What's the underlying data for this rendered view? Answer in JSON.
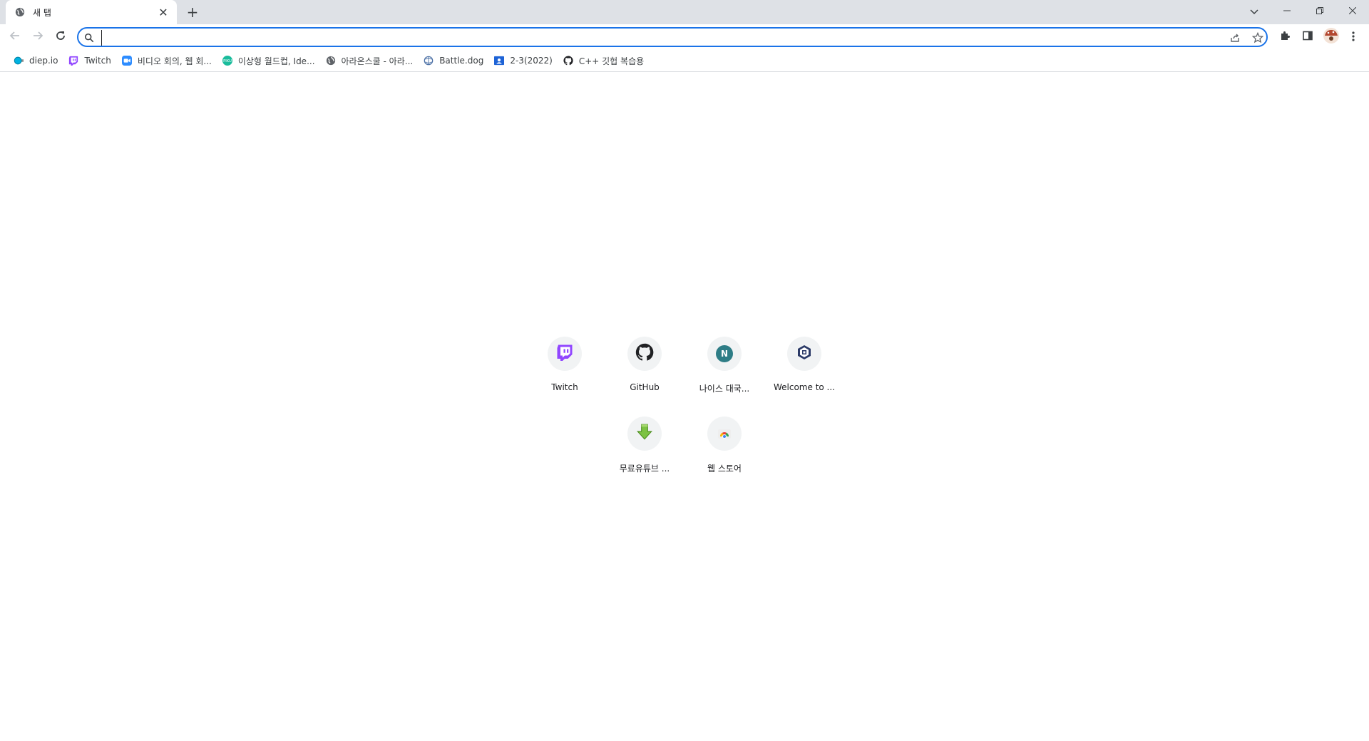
{
  "tab": {
    "title": "새 탭",
    "close": "✕"
  },
  "newtab": "+",
  "window_controls": {
    "minimize": "─",
    "restore": "❐",
    "close": "✕"
  },
  "omnibox": {
    "value": "",
    "placeholder": ""
  },
  "bookmarks": [
    {
      "label": "diep.io",
      "icon": "diep-icon"
    },
    {
      "label": "Twitch",
      "icon": "twitch-icon"
    },
    {
      "label": "비디오 회의, 웹 회...",
      "icon": "zoom-icon"
    },
    {
      "label": "이상형 월드컵, Ide...",
      "icon": "piku-icon"
    },
    {
      "label": "아라온스쿨 - 아라...",
      "icon": "globe-icon"
    },
    {
      "label": "Battle.dog",
      "icon": "battledog-icon"
    },
    {
      "label": "2-3(2022)",
      "icon": "classroom-icon"
    },
    {
      "label": "C++ 깃헙 복습용",
      "icon": "github-icon"
    }
  ],
  "shortcuts": [
    {
      "label": "Twitch",
      "icon": "twitch-icon"
    },
    {
      "label": "GitHub",
      "icon": "github-icon"
    },
    {
      "label": "나이스 대국...",
      "icon": "neis-icon",
      "letter": "N"
    },
    {
      "label": "Welcome to ...",
      "icon": "welcome-icon"
    },
    {
      "label": "무료유튜브 ...",
      "icon": "download-arrow-icon"
    },
    {
      "label": "웹 스토어",
      "icon": "webstore-icon"
    }
  ],
  "colors": {
    "accent": "#1a73e8",
    "tabstrip": "#dee1e6",
    "twitch": "#9146ff",
    "neis": "#2e7d86"
  }
}
